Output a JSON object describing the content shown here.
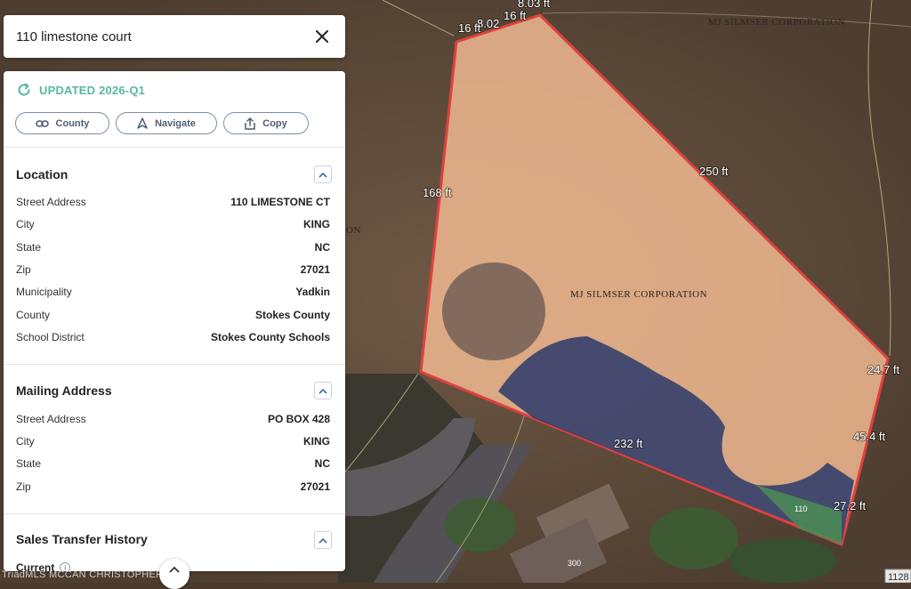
{
  "search": {
    "query": "110 limestone court"
  },
  "panel": {
    "updated": "UPDATED 2026-Q1",
    "actions": {
      "county": "County",
      "navigate": "Navigate",
      "copy": "Copy"
    },
    "location": {
      "title": "Location",
      "rows": [
        {
          "label": "Street Address",
          "value": "110 LIMESTONE CT"
        },
        {
          "label": "City",
          "value": "KING"
        },
        {
          "label": "State",
          "value": "NC"
        },
        {
          "label": "Zip",
          "value": "27021"
        },
        {
          "label": "Municipality",
          "value": "Yadkin"
        },
        {
          "label": "County",
          "value": "Stokes County"
        },
        {
          "label": "School District",
          "value": "Stokes County Schools"
        }
      ]
    },
    "mailing": {
      "title": "Mailing Address",
      "rows": [
        {
          "label": "Street Address",
          "value": "PO BOX 428"
        },
        {
          "label": "City",
          "value": "KING"
        },
        {
          "label": "State",
          "value": "NC"
        },
        {
          "label": "Zip",
          "value": "27021"
        }
      ]
    },
    "sales": {
      "title": "Sales Transfer History",
      "current": "Current"
    }
  },
  "map": {
    "dimensions": [
      "8.03 ft",
      "16 ft",
      "8.02",
      "16 ft",
      "168 ft",
      "250 ft",
      "24.7 ft",
      "45.4 ft",
      "27.2 ft",
      "232 ft"
    ],
    "owners": [
      "MJ SILMSER CORPORATION",
      "MJ SILMSER CORPORATION"
    ],
    "parcel_numbers": [
      "110",
      "300",
      "1128"
    ],
    "edge_text": "ON",
    "watermark": "TriadMLS MCCAN CHRISTOPHER",
    "colors": {
      "parcel_outline": "#e0403f",
      "parcel_fill": "#f0b890",
      "accent": "#59b8a0"
    }
  }
}
